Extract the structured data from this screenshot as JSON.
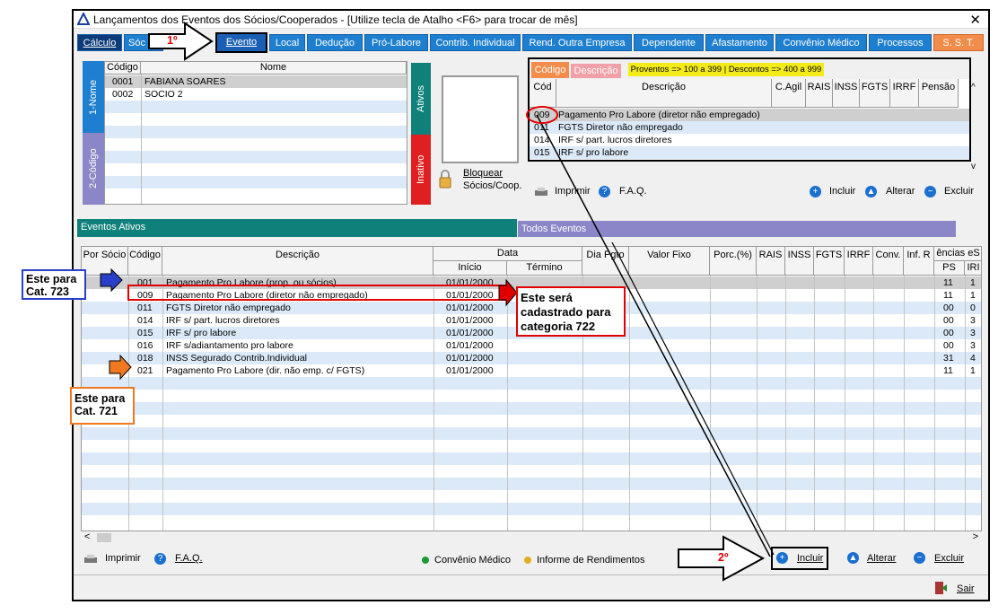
{
  "window": {
    "title": "Lançamentos dos Eventos dos Sócios/Cooperados - [Utilize tecla de Atalho <F6> para trocar de mês]",
    "close": "✕"
  },
  "tabs": [
    {
      "label": "Cálculo"
    },
    {
      "label": "Sóc"
    },
    {
      "label": "Evento"
    },
    {
      "label": "Local"
    },
    {
      "label": "Dedução"
    },
    {
      "label": "Pró-Labore"
    },
    {
      "label": "Contrib. Individual"
    },
    {
      "label": "Rend. Outra Empresa"
    },
    {
      "label": "Dependente"
    },
    {
      "label": "Afastamento"
    },
    {
      "label": "Convênio Médico"
    },
    {
      "label": "Processos"
    },
    {
      "label": "S. S. T."
    }
  ],
  "socios": {
    "headers": {
      "codigo": "Código",
      "nome": "Nome"
    },
    "rows": [
      {
        "codigo": "0001",
        "nome": "FABIANA SOARES"
      },
      {
        "codigo": "0002",
        "nome": "SOCIO 2"
      }
    ],
    "vtab_nome": "1-Nome",
    "vtab_codigo": "2-Código",
    "vtab_ativos": "Ativos",
    "vtab_inativo": "Inativo"
  },
  "bloquear": {
    "line1": "Bloquear",
    "line2": "Sócios/Coop."
  },
  "event_lookup": {
    "tab_codigo": "Código",
    "tab_descricao": "Descrição",
    "hint": "Proventos => 100 a 399 | Descontos => 400 a 999",
    "headers": [
      "Cód",
      "Descrição",
      "C.Agil",
      "RAIS",
      "INSS",
      "FGTS",
      "IRRF",
      "Pensão"
    ],
    "rows": [
      {
        "cod": "009",
        "desc": "Pagamento Pro Labore (diretor não empregado)"
      },
      {
        "cod": "011",
        "desc": "FGTS Diretor não empregado"
      },
      {
        "cod": "014",
        "desc": "IRF s/ part. lucros diretores"
      },
      {
        "cod": "015",
        "desc": "IRF s/ pro labore"
      }
    ]
  },
  "top_actions": {
    "imprimir": "Imprimir",
    "faq": "F.A.Q.",
    "incluir": "Incluir",
    "alterar": "Alterar",
    "excluir": "Excluir"
  },
  "section_tabs": {
    "ativos": "Eventos Ativos",
    "todos": "Todos Eventos"
  },
  "events_grid": {
    "headers": {
      "por_socio": "Por Sócio",
      "codigo": "Código",
      "descricao": "Descrição",
      "data": "Data",
      "inicio": "Início",
      "termino": "Término",
      "dia_pgto": "Dia Pgto",
      "valor_fixo": "Valor Fixo",
      "porc": "Porc.(%)",
      "rais": "RAIS",
      "inss": "INSS",
      "fgts": "FGTS",
      "irrf": "IRRF",
      "conv": "Conv.",
      "inf_r": "Inf. R",
      "encias": "ências eS",
      "ps": "PS",
      "iri": "IRI"
    },
    "rows": [
      {
        "codigo": "001",
        "descricao": "Pagamento Pro Labore (prop. ou sócios)",
        "inicio": "01/01/2000",
        "ps": "11",
        "iri": "1"
      },
      {
        "codigo": "009",
        "descricao": "Pagamento Pro Labore (diretor não empregado)",
        "inicio": "01/01/2000",
        "ps": "11",
        "iri": "1"
      },
      {
        "codigo": "011",
        "descricao": "FGTS Diretor não empregado",
        "inicio": "01/01/2000",
        "ps": "00",
        "iri": "0"
      },
      {
        "codigo": "014",
        "descricao": "IRF s/ part. lucros diretores",
        "inicio": "01/01/2000",
        "ps": "00",
        "iri": "3"
      },
      {
        "codigo": "015",
        "descricao": "IRF s/ pro labore",
        "inicio": "01/01/2000",
        "ps": "00",
        "iri": "3"
      },
      {
        "codigo": "016",
        "descricao": "IRF s/adiantamento pro labore",
        "inicio": "01/01/2000",
        "ps": "00",
        "iri": "3"
      },
      {
        "codigo": "018",
        "descricao": "INSS Segurado Contrib.Individual",
        "inicio": "01/01/2000",
        "ps": "31",
        "iri": "4"
      },
      {
        "codigo": "021",
        "descricao": "Pagamento Pro Labore (dir. não emp. c/ FGTS)",
        "inicio": "01/01/2000",
        "ps": "11",
        "iri": "1"
      }
    ]
  },
  "bottom": {
    "imprimir": "Imprimir",
    "faq": "F.A.Q.",
    "convenio": "Convênio Médico",
    "informe": "Informe de Rendimentos",
    "incluir": "Incluir",
    "alterar": "Alterar",
    "excluir": "Excluir",
    "sair": "Sair"
  },
  "annotations": {
    "step1": "1º",
    "step2": "2º",
    "cat723_l1": "Este para",
    "cat723_l2": "Cat. 723",
    "cat721_l1": "Este para",
    "cat721_l2": "Cat. 721",
    "cat722_l1": "Este será",
    "cat722_l2": "cadastrado para",
    "cat722_l3": "categoria 722"
  },
  "colors": {
    "tab_blue": "#1e7fd0",
    "tab_orange": "#f28c4a",
    "green_tab": "#10807a",
    "red_tab": "#e02020",
    "purple": "#8a86c8",
    "annotation_red": "#e00000",
    "annotation_blue": "#2a3fc8",
    "annotation_orange": "#f07820"
  }
}
